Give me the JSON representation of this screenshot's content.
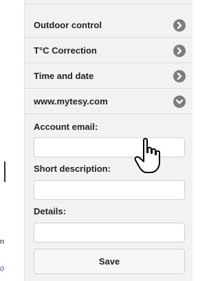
{
  "left_edge": {
    "text_fragment": "n",
    "link_fragment": "o"
  },
  "menu": {
    "items": [
      {
        "label": "Outdoor control",
        "icon": "chevron-right-icon"
      },
      {
        "label": "T°C Correction",
        "icon": "chevron-right-icon"
      },
      {
        "label": "Time and date",
        "icon": "chevron-right-icon"
      },
      {
        "label": "www.mytesy.com",
        "icon": "chevron-down-icon"
      }
    ]
  },
  "form": {
    "account_email_label": "Account email:",
    "account_email_value": "",
    "short_description_label": "Short description:",
    "short_description_value": "",
    "details_label": "Details:",
    "details_value": "",
    "save_label": "Save"
  },
  "colors": {
    "panel_bg": "#f2f2f2",
    "chevron_bg": "#7d7d7d",
    "link": "#6a3ab0"
  }
}
